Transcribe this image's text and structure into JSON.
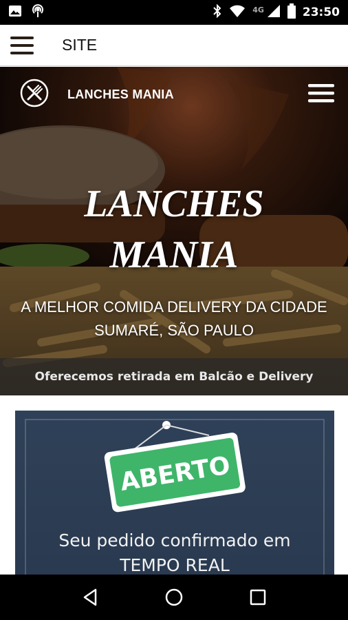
{
  "status_bar": {
    "time": "23:50",
    "network": "4G",
    "icons": [
      "image-icon",
      "podcast-icon",
      "bluetooth-icon",
      "wifi-icon",
      "signal-icon",
      "battery-icon"
    ]
  },
  "app_bar": {
    "title": "SITE",
    "menu_icon": "hamburger-menu-icon"
  },
  "site_header": {
    "brand": "LANCHES MANIA",
    "logo_icon": "fork-knife-logo-icon",
    "menu_icon": "hamburger-menu-icon"
  },
  "hero": {
    "title_line1": "LANCHES",
    "title_line2": "MANIA",
    "subtitle_line1": "A MELHOR COMIDA DELIVERY DA CIDADE",
    "subtitle_line2": "SUMARÉ, SÃO PAULO",
    "strip_text": "Oferecemos retirada em Balcão e Delivery"
  },
  "promo": {
    "sign_text": "ABERTO",
    "sign_color": "#3fb56a",
    "text_line1": "Seu pedido confirmado em",
    "text_line2": "TEMPO REAL"
  },
  "nav_bar": {
    "buttons": [
      "back-icon",
      "home-icon",
      "recents-icon"
    ]
  }
}
